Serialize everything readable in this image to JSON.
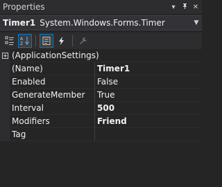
{
  "window": {
    "title": "Properties",
    "pin_glyph": "▾",
    "autohide_glyph": "ᛘ",
    "close_glyph": "✕"
  },
  "object_selector": {
    "name": "Timer1",
    "type": "System.Windows.Forms.Timer"
  },
  "toolbar": {
    "buttons": [
      {
        "name": "categorized-icon",
        "active": false
      },
      {
        "name": "alphabetical-icon",
        "active": true
      },
      {
        "name": "properties-icon",
        "active": true
      },
      {
        "name": "events-icon",
        "active": false
      },
      {
        "name": "property-pages-icon",
        "active": false
      }
    ]
  },
  "grid": {
    "category": {
      "label": "(ApplicationSettings)"
    },
    "properties": [
      {
        "name": "(Name)",
        "value": "Timer1",
        "bold": true
      },
      {
        "name": "Enabled",
        "value": "False",
        "bold": false
      },
      {
        "name": "GenerateMember",
        "value": "True",
        "bold": false
      },
      {
        "name": "Interval",
        "value": "500",
        "bold": true
      },
      {
        "name": "Modifiers",
        "value": "Friend",
        "bold": true
      },
      {
        "name": "Tag",
        "value": "",
        "bold": false
      }
    ]
  },
  "colors": {
    "accent": "#007acc",
    "background": "#252526",
    "text": "#f1f1f1"
  }
}
